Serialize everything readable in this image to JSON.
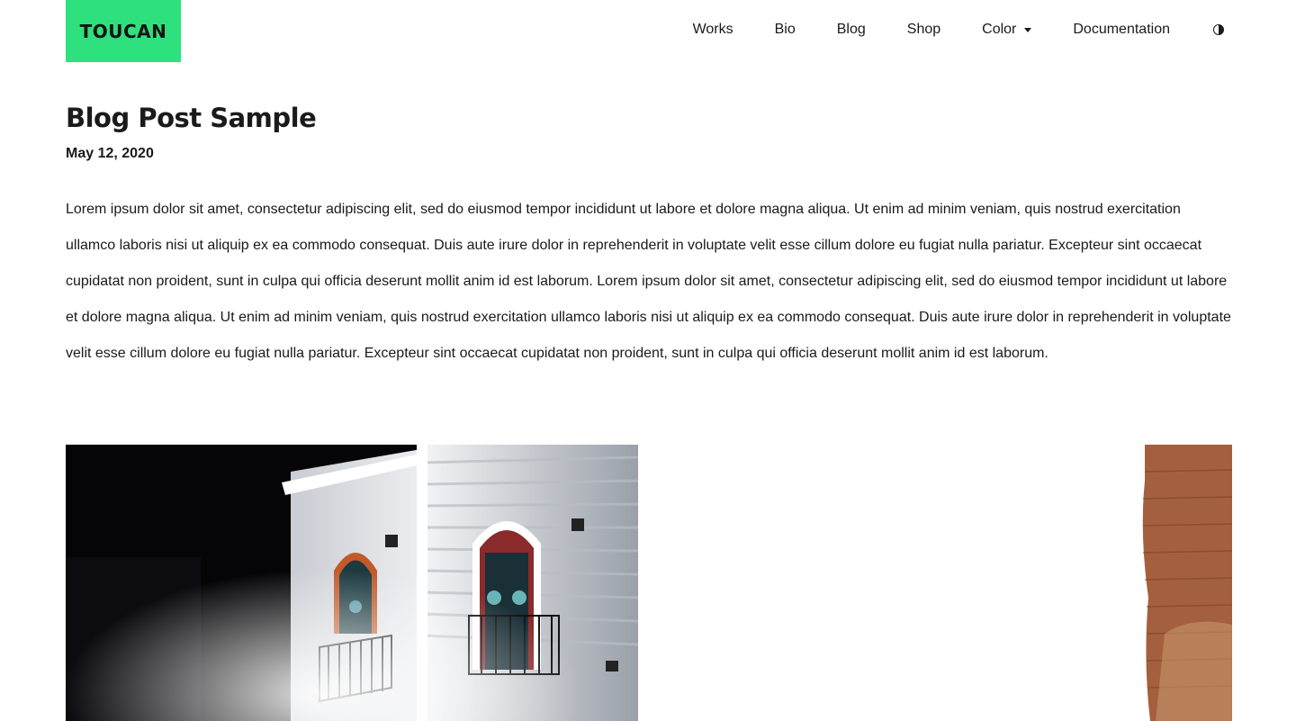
{
  "header": {
    "logo": "TOUCAN",
    "nav": [
      {
        "label": "Works"
      },
      {
        "label": "Bio"
      },
      {
        "label": "Blog"
      },
      {
        "label": "Shop"
      },
      {
        "label": "Color",
        "has_dropdown": true
      },
      {
        "label": "Documentation"
      }
    ],
    "theme_toggle_icon": "contrast-icon"
  },
  "post": {
    "title": "Blog Post Sample",
    "date": "May 12, 2020",
    "body": "Lorem ipsum dolor sit amet, consectetur adipiscing elit, sed do eiusmod tempor incididunt ut labore et dolore magna aliqua. Ut enim ad minim veniam, quis nostrud exercitation ullamco laboris nisi ut aliquip ex ea commodo consequat. Duis aute irure dolor in reprehenderit in voluptate velit esse cillum dolore eu fugiat nulla pariatur. Excepteur sint occaecat cupidatat non proident, sunt in culpa qui officia deserunt mollit anim id est laborum. Lorem ipsum dolor sit amet, consectetur adipiscing elit, sed do eiusmod tempor incididunt ut labore et dolore magna aliqua. Ut enim ad minim veniam, quis nostrud exercitation ullamco laboris nisi ut aliquip ex ea commodo consequat. Duis aute irure dolor in reprehenderit in voluptate velit esse cillum dolore eu fugiat nulla pariatur. Excepteur sint occaecat cupidatat non proident, sunt in culpa qui officia deserunt mollit anim id est laborum."
  },
  "colors": {
    "brand": "#2ee07e",
    "text": "#1a1a1a",
    "background": "#ffffff"
  }
}
